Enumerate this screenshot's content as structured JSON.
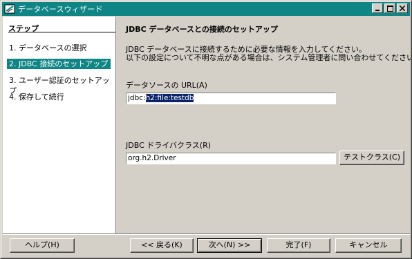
{
  "window": {
    "title": "データベースウィザード"
  },
  "sidebar": {
    "heading": "ステップ",
    "steps": [
      {
        "label": "1.  データベースの選択"
      },
      {
        "label": "2.  JDBC 接続のセットアップ"
      },
      {
        "label": "3.  ユーザー認証のセットアップ"
      },
      {
        "label": "4.  保存して続行"
      }
    ]
  },
  "main": {
    "heading": "JDBC データベースとの接続のセットアップ",
    "desc_line1": "JDBC データベースに接続するために必要な情報を入力してください。",
    "desc_line2": "以下の設定について不明な点がある場合は、システム管理者に問い合わせてください。",
    "url_label": "データソースの URL(A)",
    "url_prefix": "jdbc:",
    "url_selected": "h2:file:testdb",
    "driver_label": "JDBC ドライバクラス(R)",
    "driver_value": "org.h2.Driver",
    "test_class_label": "テストクラス(C)"
  },
  "footer": {
    "help": "ヘルプ(H)",
    "back": "<< 戻る(K)",
    "next": "次へ(N) >>",
    "finish": "完了(F)",
    "cancel": "キャンセル"
  },
  "colors": {
    "accent": "#0f8585",
    "selection": "#0a246a"
  }
}
